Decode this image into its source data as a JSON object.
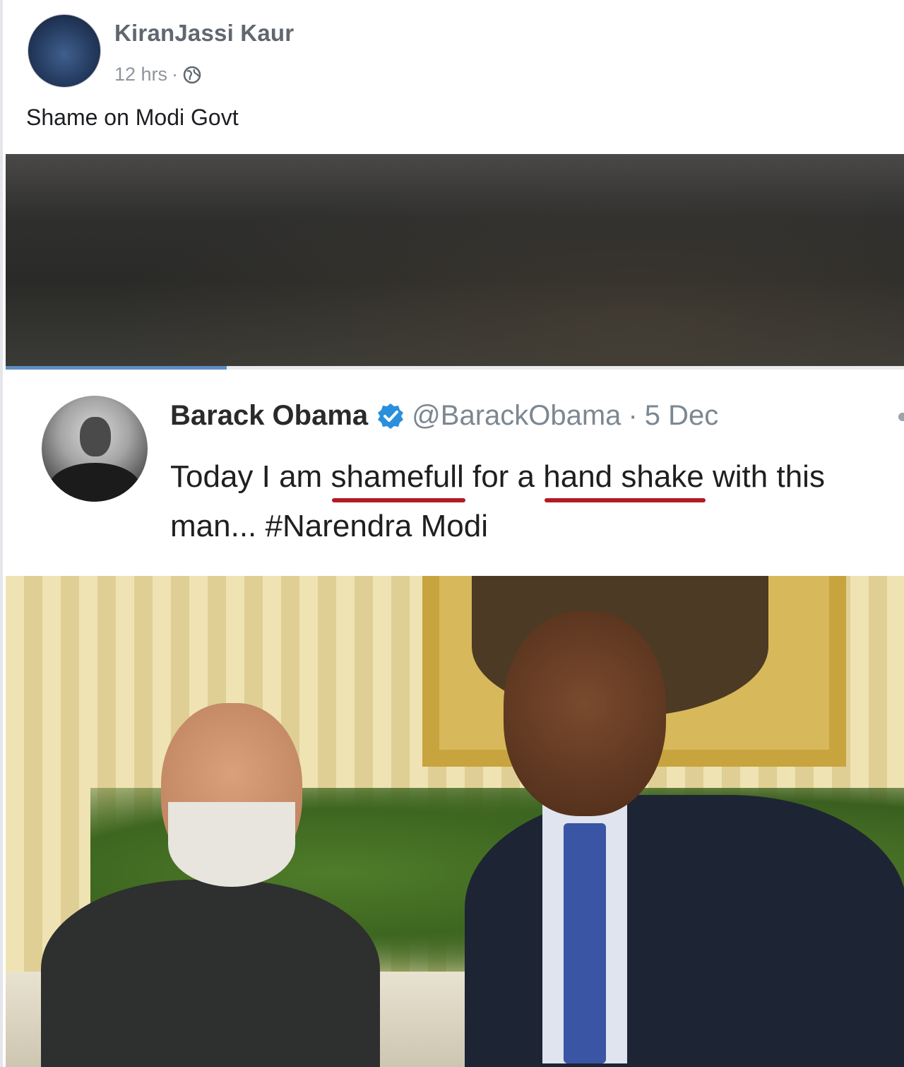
{
  "post": {
    "author": "KiranJassi Kaur",
    "time": "12 hrs",
    "separator": "·",
    "privacy_icon": "globe-icon",
    "text": "Shame on Modi Govt"
  },
  "video_progress": 0.245,
  "tweet": {
    "name": "Barack Obama",
    "verified_icon": "verified-badge-icon",
    "handle": "@BarackObama",
    "separator": "·",
    "date": "5 Dec",
    "text_1": "Today I am ",
    "text_underlined_1": "shamefull",
    "text_2": " for a ",
    "text_underlined_2": "hand shake",
    "text_3": " with this man... #Narendra Modi",
    "underline_color": "#b31b22"
  }
}
